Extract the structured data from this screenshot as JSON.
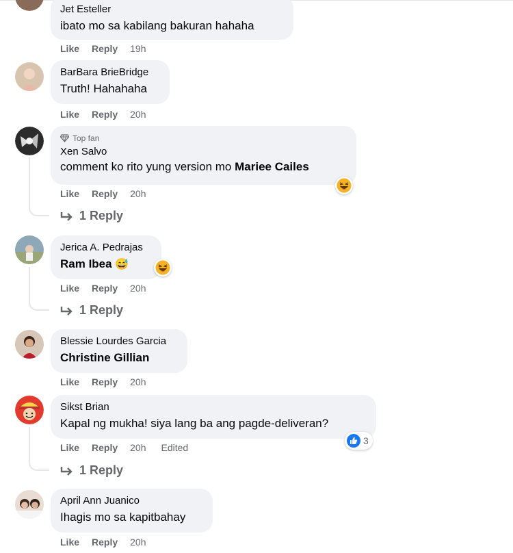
{
  "actions": {
    "like": "Like",
    "reply": "Reply"
  },
  "comments": [
    {
      "author": "Jet Esteller",
      "text": "ibato mo sa kabilang bakuran hahaha",
      "time": "19h"
    },
    {
      "author": "BarBara BrieBridge",
      "text": "Truth! Hahahaha",
      "time": "20h"
    },
    {
      "badge": "Top fan",
      "author": "Xen Salvo",
      "text": "comment ko rito yung version mo ",
      "mention": "Mariee Cailes",
      "time": "20h",
      "replies": "1 Reply",
      "reaction": "haha"
    },
    {
      "author": "Jerica A. Pedrajas",
      "text": "Ram Ibea",
      "emoji": "😅",
      "time": "20h",
      "replies": "1 Reply",
      "reaction": "haha"
    },
    {
      "author": "Blessie Lourdes Garcia",
      "text": "Christine Gillian",
      "time": "20h"
    },
    {
      "author": "Sikst Brian",
      "text": "Kapal ng mukha! siya lang ba ang pagde-deliveran?",
      "time": "20h",
      "edited": "Edited",
      "replies": "1 Reply",
      "reaction": "like",
      "reaction_count": "3"
    },
    {
      "author": "April Ann Juanico",
      "text": "Ihagis mo sa kapitbahay",
      "time": "20h"
    }
  ],
  "colors": {
    "bubble": "#f0f2f5",
    "secondary_text": "#65676b",
    "like_blue": "#1877f2",
    "haha_yellow": "#f7b125"
  }
}
